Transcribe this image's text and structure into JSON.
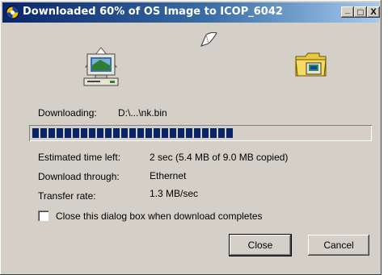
{
  "window": {
    "title": "Downloaded 60% of OS Image to ICOP_6042",
    "minimize_glyph": "_",
    "maximize_glyph": "□",
    "close_glyph": "X"
  },
  "download": {
    "label": "Downloading:",
    "file": "D:\\...\\nk.bin",
    "progress_fraction": 0.6
  },
  "details": {
    "estimated_label": "Estimated time left:",
    "estimated_value": "2 sec (5.4 MB of 9.0 MB copied)",
    "through_label": "Download through:",
    "through_value": "Ethernet",
    "rate_label": "Transfer rate:",
    "rate_value": "1.3 MB/sec"
  },
  "options": {
    "close_on_complete_label": "Close this dialog box when download completes",
    "close_on_complete_checked": false
  },
  "buttons": {
    "close_label": "Close",
    "cancel_label": "Cancel"
  },
  "icons": {
    "app": "globe-icon",
    "source": "computer-icon",
    "flying": "paper-icon",
    "target": "folder-device-icon"
  },
  "colors": {
    "titlebar_start": "#0a246a",
    "titlebar_end": "#a6caf0",
    "progress": "#0a246a",
    "dialog_bg": "#d4d0c8"
  }
}
